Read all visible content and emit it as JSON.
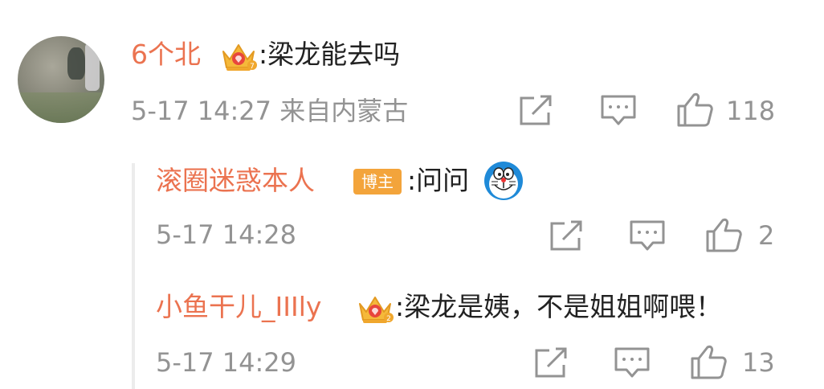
{
  "comment": {
    "username": "6个北",
    "text": ":梁龙能去吗",
    "meta": "5-17 14:27 来自内蒙古",
    "like_count": "118",
    "crown_level": "7"
  },
  "replies": [
    {
      "username": "滚圈迷惑本人",
      "badge": "博主",
      "text": ":问问",
      "meta": "5-17 14:28",
      "like_count": "2"
    },
    {
      "username": "小鱼干儿_IIIly",
      "text": ":梁龙是姨，不是姐姐啊喂！",
      "meta": "5-17 14:29",
      "like_count": "13",
      "crown_level": "2"
    }
  ],
  "colors": {
    "username": "#eb7350",
    "meta": "#939393",
    "badge": "#f3a43b",
    "crown": "#f5b93a"
  }
}
